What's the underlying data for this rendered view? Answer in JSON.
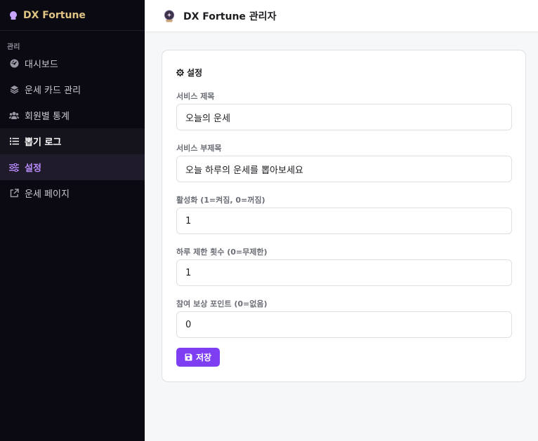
{
  "brand": {
    "name": "DX Fortune",
    "icon": "crystal-ball-icon",
    "color": "#e0c483"
  },
  "sidebar": {
    "section_label": "관리",
    "items": [
      {
        "label": "대시보드",
        "icon": "dashboard-icon"
      },
      {
        "label": "운세 카드 관리",
        "icon": "layers-icon"
      },
      {
        "label": "회원별 통계",
        "icon": "users-icon"
      },
      {
        "label": "뽑기 로그",
        "icon": "list-icon"
      },
      {
        "label": "설정",
        "icon": "sliders-icon"
      },
      {
        "label": "운세 페이지",
        "icon": "external-link-icon"
      }
    ],
    "active_color": "#b98cff"
  },
  "header": {
    "title": "DX Fortune 관리자",
    "icon": "crystal-ball-icon"
  },
  "settings": {
    "title": "설정",
    "title_icon": "gear-icon",
    "fields": [
      {
        "label": "서비스 제목",
        "value": "오늘의 운세"
      },
      {
        "label": "서비스 부제목",
        "value": "오늘 하루의 운세를 뽑아보세요"
      },
      {
        "label": "활성화 (1=켜짐, 0=꺼짐)",
        "value": "1"
      },
      {
        "label": "하루 제한 횟수 (0=무제한)",
        "value": "1"
      },
      {
        "label": "참여 보상 포인트 (0=없음)",
        "value": "0"
      }
    ],
    "save_label": "저장",
    "save_icon": "save-icon",
    "accent": "#7e3ff2"
  }
}
